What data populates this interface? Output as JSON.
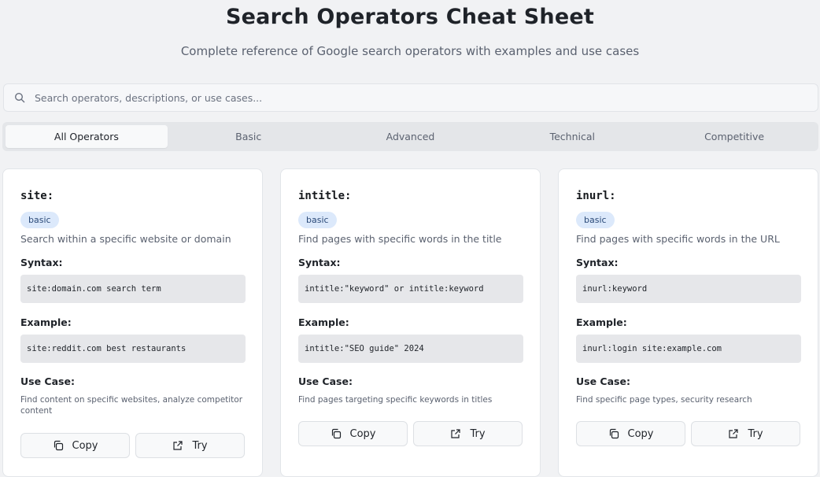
{
  "header": {
    "title": "Search Operators Cheat Sheet",
    "subtitle": "Complete reference of Google search operators with examples and use cases"
  },
  "search": {
    "placeholder": "Search operators, descriptions, or use cases...",
    "value": ""
  },
  "tabs": [
    {
      "label": "All Operators",
      "active": true
    },
    {
      "label": "Basic",
      "active": false
    },
    {
      "label": "Advanced",
      "active": false
    },
    {
      "label": "Technical",
      "active": false
    },
    {
      "label": "Competitive",
      "active": false
    }
  ],
  "labels": {
    "syntax": "Syntax:",
    "example": "Example:",
    "use_case": "Use Case:",
    "copy": "Copy",
    "try": "Try"
  },
  "cards": [
    {
      "operator": "site:",
      "category": "basic",
      "description": "Search within a specific website or domain",
      "syntax": "site:domain.com search term",
      "example": "site:reddit.com best restaurants",
      "use_case": "Find content on specific websites, analyze competitor content"
    },
    {
      "operator": "intitle:",
      "category": "basic",
      "description": "Find pages with specific words in the title",
      "syntax": "intitle:\"keyword\" or intitle:keyword",
      "example": "intitle:\"SEO guide\" 2024",
      "use_case": "Find pages targeting specific keywords in titles"
    },
    {
      "operator": "inurl:",
      "category": "basic",
      "description": "Find pages with specific words in the URL",
      "syntax": "inurl:keyword",
      "example": "inurl:login site:example.com",
      "use_case": "Find specific page types, security research"
    }
  ],
  "colors": {
    "background": "#f1f2f4",
    "badge_bg": "#dce9fb",
    "badge_text": "#2b4a78",
    "code_bg": "#e6e7ea"
  },
  "icons": {
    "search": "search-icon",
    "copy": "copy-icon",
    "try": "external-link-icon"
  }
}
